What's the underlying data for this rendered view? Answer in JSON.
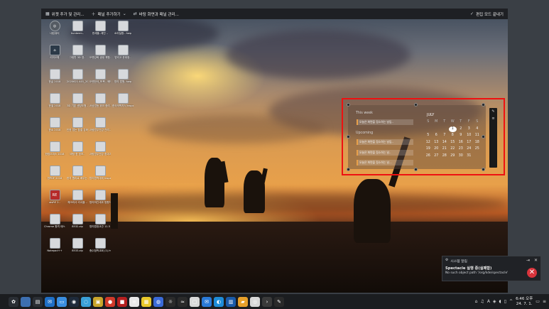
{
  "edit_bar": {
    "widgets_label": "위젯 추가 및 관리...",
    "add_panel_label": "패널 추가하기",
    "wallpaper_label": "바탕 화면과 패널 관리...",
    "done_label": "편집 모드 끝내기"
  },
  "desktop_icons": [
    {
      "label": "내컴퓨터",
      "col": 0,
      "row": 0,
      "style": "round",
      "glyph": "◎"
    },
    {
      "label": "hunkerm..",
      "col": 1,
      "row": 0,
      "style": "",
      "glyph": ""
    },
    {
      "label": "한세플..제인 ..",
      "col": 2,
      "row": 0,
      "style": "",
      "glyph": ""
    },
    {
      "label": "소아질환...hwp",
      "col": 3,
      "row": 0,
      "style": "",
      "glyph": ""
    },
    {
      "label": "리미오톡",
      "col": 0,
      "row": 1,
      "style": "dark",
      "glyph": "⌂"
    },
    {
      "label": "그림판 3D 영..",
      "col": 1,
      "row": 1,
      "style": "",
      "glyph": ""
    },
    {
      "label": "오랜강화 생생 체험..",
      "col": 2,
      "row": 1,
      "style": "",
      "glyph": ""
    },
    {
      "label": "방리고 문위정..",
      "col": 3,
      "row": 1,
      "style": "",
      "glyph": ""
    },
    {
      "label": "한글 2018",
      "col": 0,
      "row": 2,
      "style": "",
      "glyph": ""
    },
    {
      "label": "2020621 A01_201947..",
      "col": 1,
      "row": 2,
      "style": "",
      "glyph": ""
    },
    {
      "label": "오랜한국_또목.. 메타만..",
      "col": 2,
      "row": 2,
      "style": "",
      "glyph": ""
    },
    {
      "label": "방리 법원..hwp",
      "col": 3,
      "row": 2,
      "style": "",
      "glyph": ""
    },
    {
      "label": "한셀 2018",
      "col": 0,
      "row": 3,
      "style": "",
      "glyph": ""
    },
    {
      "label": "3D 기본 센딩도형..",
      "col": 1,
      "row": 3,
      "style": "",
      "glyph": ""
    },
    {
      "label": "서상업등 위크 중리.hwp",
      "col": 2,
      "row": 3,
      "style": "",
      "glyph": ""
    },
    {
      "label": "한국의학지식 hwpx",
      "col": 3,
      "row": 3,
      "style": "",
      "glyph": ""
    },
    {
      "label": "한쇼 2018",
      "col": 0,
      "row": 4,
      "style": "",
      "glyph": ""
    },
    {
      "label": "인한 접는 참결 강화..",
      "col": 1,
      "row": 4,
      "style": "",
      "glyph": ""
    },
    {
      "label": "사람업무건강 관리..",
      "col": 2,
      "row": 4,
      "style": "",
      "glyph": ""
    },
    {
      "label": "한컴오피스 2018",
      "col": 0,
      "row": 5,
      "style": "",
      "glyph": ""
    },
    {
      "label": "바탕 한 정보..",
      "col": 1,
      "row": 5,
      "style": "",
      "glyph": ""
    },
    {
      "label": "사랑업무건강 중괴과 선정..",
      "col": 2,
      "row": 5,
      "style": "",
      "glyph": ""
    },
    {
      "label": "한PDF 2018",
      "col": 0,
      "row": 6,
      "style": "",
      "glyph": ""
    },
    {
      "label": "한자 원리로 배우는..",
      "col": 1,
      "row": 6,
      "style": "",
      "glyph": ""
    },
    {
      "label": "방리법학대세 hwpx",
      "col": 2,
      "row": 6,
      "style": "",
      "glyph": ""
    },
    {
      "label": "aisRE 2..",
      "col": 0,
      "row": 7,
      "style": "red",
      "glyph": "RE"
    },
    {
      "label": "체크리사 리서클...",
      "col": 1,
      "row": 7,
      "style": "",
      "glyph": ""
    },
    {
      "label": "방리마관세과 범원지.hwpx",
      "col": 2,
      "row": 7,
      "style": "",
      "glyph": ""
    },
    {
      "label": "Chrome 원격 데스크톱",
      "col": 0,
      "row": 8,
      "style": "",
      "glyph": ""
    },
    {
      "label": "8532.zip",
      "col": 1,
      "row": 8,
      "style": "",
      "glyph": ""
    },
    {
      "label": "방리법정교관 11.5 주.hwpx",
      "col": 2,
      "row": 8,
      "style": "",
      "glyph": ""
    },
    {
      "label": "Notepad++",
      "col": 0,
      "row": 9,
      "style": "",
      "glyph": ""
    },
    {
      "label": "8533.zip",
      "col": 1,
      "row": 9,
      "style": "",
      "glyph": ""
    },
    {
      "label": "증수첩학교회 (1).hwpx",
      "col": 2,
      "row": 9,
      "style": "",
      "glyph": ""
    }
  ],
  "calendar": {
    "this_week_title": "This week",
    "upcoming_title": "Upcoming",
    "events": [
      "오늘은 화면을 정소하는 날입..",
      "오늘은 화면을 정소하는 날입..",
      "오늘은 화면을 정소하는 날..",
      "오늘은 화면을 정소하는 날..."
    ],
    "month": "JULY",
    "weekdays": [
      "S",
      "M",
      "T",
      "W",
      "T",
      "F",
      "S"
    ],
    "days": [
      "",
      "",
      "",
      "1",
      "2",
      "3",
      "4",
      "5",
      "6",
      "7",
      "8",
      "9",
      "10",
      "11",
      "12",
      "13",
      "14",
      "15",
      "16",
      "17",
      "18",
      "19",
      "20",
      "21",
      "22",
      "23",
      "24",
      "25",
      "26",
      "27",
      "28",
      "29",
      "30",
      "31",
      ""
    ],
    "today": "1"
  },
  "notification": {
    "header": "시스템 알림",
    "title": "Spectacle 실행 중(실패함)",
    "body": "No such object path '/org/kde/spectacle'",
    "status_color": "#d8343c"
  },
  "taskbar": {
    "clock_time": "6:46 오후",
    "clock_date": "24. 7. 1.",
    "apps": [
      {
        "name": "app-launcher-icon",
        "color": "#2b2f35",
        "glyph": "✿"
      },
      {
        "name": "desktop-pager-icon",
        "color": "#3d6fb0",
        "glyph": ""
      },
      {
        "name": "task-manager-icon",
        "color": "#2b2f35",
        "glyph": "▤"
      },
      {
        "name": "outlook-icon",
        "color": "#1f6fc6",
        "glyph": "✉"
      },
      {
        "name": "file-manager-icon",
        "color": "#3a8ee0",
        "glyph": "▭"
      },
      {
        "name": "steam-icon",
        "color": "#1e2a3a",
        "glyph": "◉"
      },
      {
        "name": "sync-icon",
        "color": "#3aa0d8",
        "glyph": "◌"
      },
      {
        "name": "archive-icon",
        "color": "#c9a52b",
        "glyph": "▣"
      },
      {
        "name": "game-icon",
        "color": "#d03a2a",
        "glyph": "●"
      },
      {
        "name": "app-red-icon",
        "color": "#b52020",
        "glyph": "■"
      },
      {
        "name": "document-icon",
        "color": "#e8e8e8",
        "glyph": "≡"
      },
      {
        "name": "notes-icon",
        "color": "#e8c82a",
        "glyph": "▦"
      },
      {
        "name": "browser-icon",
        "color": "#3a6ad8",
        "glyph": "◍"
      },
      {
        "name": "tools-icon",
        "color": "#2a2a2a",
        "glyph": "☼"
      },
      {
        "name": "vpn-icon",
        "color": "#2a2a2a",
        "glyph": "≈"
      },
      {
        "name": "monitor-icon",
        "color": "#d8d8d8",
        "glyph": "▢"
      },
      {
        "name": "mail-icon",
        "color": "#2a7ad8",
        "glyph": "✉"
      },
      {
        "name": "edge-icon",
        "color": "#1e8cd8",
        "glyph": "◐"
      },
      {
        "name": "display-icon",
        "color": "#1a5aa8",
        "glyph": "▥"
      },
      {
        "name": "folder-icon",
        "color": "#e8a02a",
        "glyph": "▰"
      },
      {
        "name": "chrome-icon",
        "color": "#d8d8d8",
        "glyph": "◎"
      },
      {
        "name": "terminal-icon",
        "color": "#3a3a3a",
        "glyph": "›"
      },
      {
        "name": "paint-icon",
        "color": "#2a2a2a",
        "glyph": "✎"
      }
    ]
  }
}
